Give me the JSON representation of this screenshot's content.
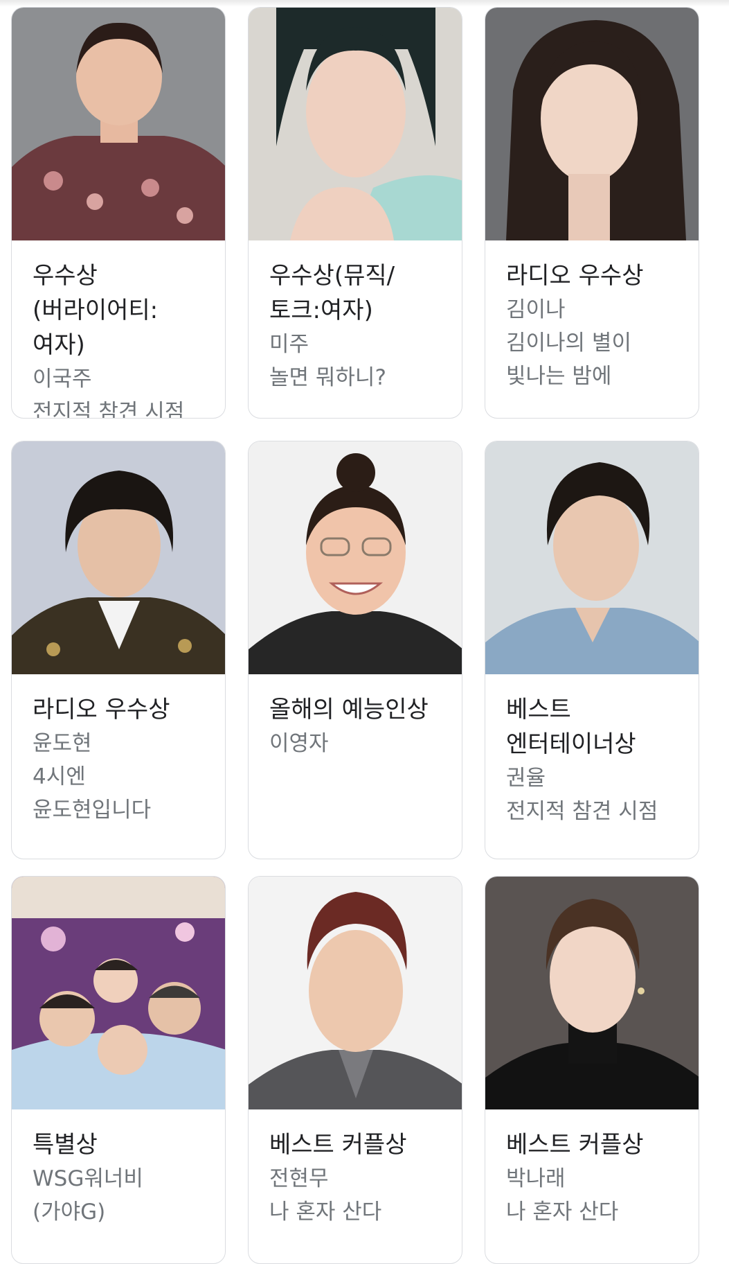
{
  "cards": [
    {
      "title": "우수상(버라이어티:여자)",
      "name": "이국주",
      "program": "전지적 참견 시점"
    },
    {
      "title": "우수상(뮤직/토크:여자)",
      "name": "미주",
      "program": "놀면 뭐하니?"
    },
    {
      "title": "라디오 우수상",
      "name": "김이나",
      "program": "김이나의 별이 빛나는 밤에"
    },
    {
      "title": "라디오 우수상",
      "name": "윤도현",
      "program": "4시엔 윤도현입니다"
    },
    {
      "title": "올해의 예능인상",
      "name": "이영자",
      "program": ""
    },
    {
      "title": "베스트 엔터테이너상",
      "name": "권율",
      "program": "전지적 참견 시점"
    },
    {
      "title": "특별상",
      "name": "WSG워너비(가야G)",
      "program": ""
    },
    {
      "title": "베스트 커플상",
      "name": "전현무",
      "program": "나 혼자 산다"
    },
    {
      "title": "베스트 커플상",
      "name": "박나래",
      "program": "나 혼자 산다"
    }
  ]
}
